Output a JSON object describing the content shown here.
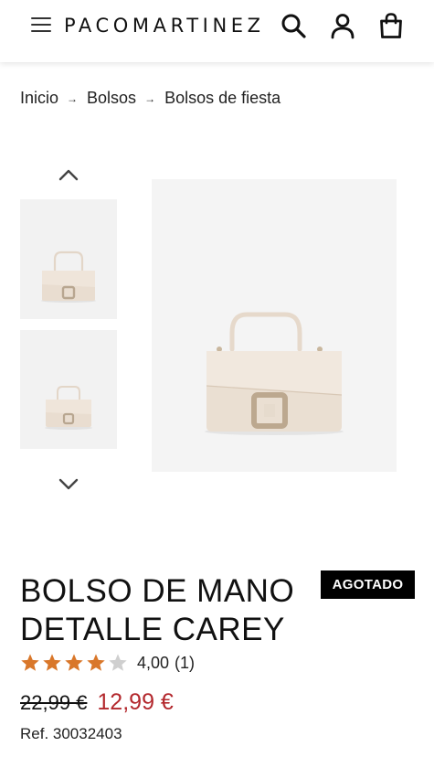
{
  "header": {
    "brand": "PACOMARTINEZ",
    "menu_icon": "hamburger-menu-icon",
    "search_icon": "search-icon",
    "account_icon": "user-icon",
    "cart_icon": "shopping-bag-icon"
  },
  "breadcrumb": {
    "items": [
      "Inicio",
      "Bolsos",
      "Bolsos de fiesta"
    ],
    "separator": "→"
  },
  "gallery": {
    "up_icon": "chevron-up-icon",
    "down_icon": "chevron-down-icon",
    "thumbnails": [
      "handbag-front-view",
      "handbag-front-view-small"
    ],
    "main_image": "beige-handbag-tortoiseshell-buckle"
  },
  "product": {
    "title": "BOLSO DE MANO DETALLE CAREY",
    "badge": "AGOTADO",
    "rating": {
      "value": "4,00",
      "count": "(1)",
      "stars_filled": 4,
      "stars_total": 5,
      "star_color": "#d9772a"
    },
    "old_price": "22,99 €",
    "new_price": "12,99 €",
    "sale_color": "#b3282d",
    "ref": "Ref. 30032403"
  }
}
